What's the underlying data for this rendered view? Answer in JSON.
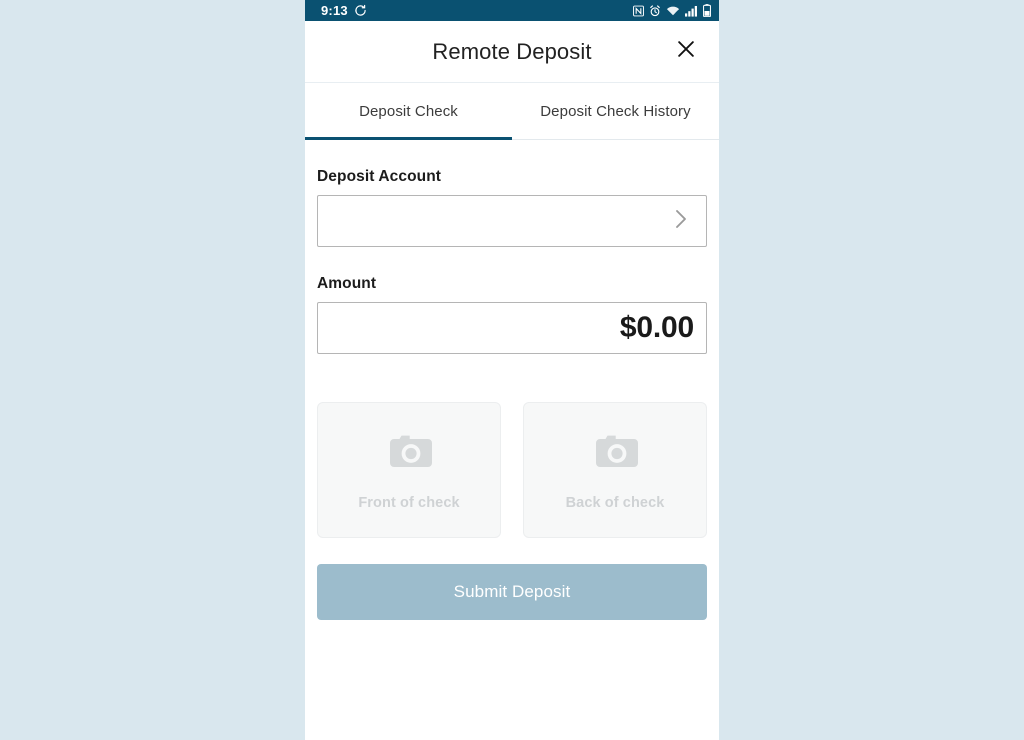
{
  "statusbar": {
    "time": "9:13",
    "sync_icon": "sync-icon",
    "icons": [
      "nfc-icon",
      "alarm-icon",
      "wifi-icon",
      "signal-icon",
      "battery-icon"
    ],
    "background_color": "#0a5171",
    "foreground_color": "#ffffff"
  },
  "header": {
    "title": "Remote Deposit",
    "close_icon": "close-icon"
  },
  "tabs": [
    {
      "label": "Deposit Check",
      "active": true
    },
    {
      "label": "Deposit Check History",
      "active": false
    }
  ],
  "form": {
    "account": {
      "label": "Deposit Account",
      "value": "",
      "placeholder": "",
      "chevron_icon": "chevron-right-icon"
    },
    "amount": {
      "label": "Amount",
      "value": "$0.00"
    },
    "captures": [
      {
        "label": "Front of check",
        "icon": "camera-icon"
      },
      {
        "label": "Back of check",
        "icon": "camera-icon"
      }
    ],
    "submit": {
      "label": "Submit Deposit",
      "enabled": false,
      "color": "#9cbccc"
    }
  },
  "theme": {
    "page_background": "#d9e7ee",
    "accent": "#0a5171",
    "card_background": "#f7f8f8"
  }
}
